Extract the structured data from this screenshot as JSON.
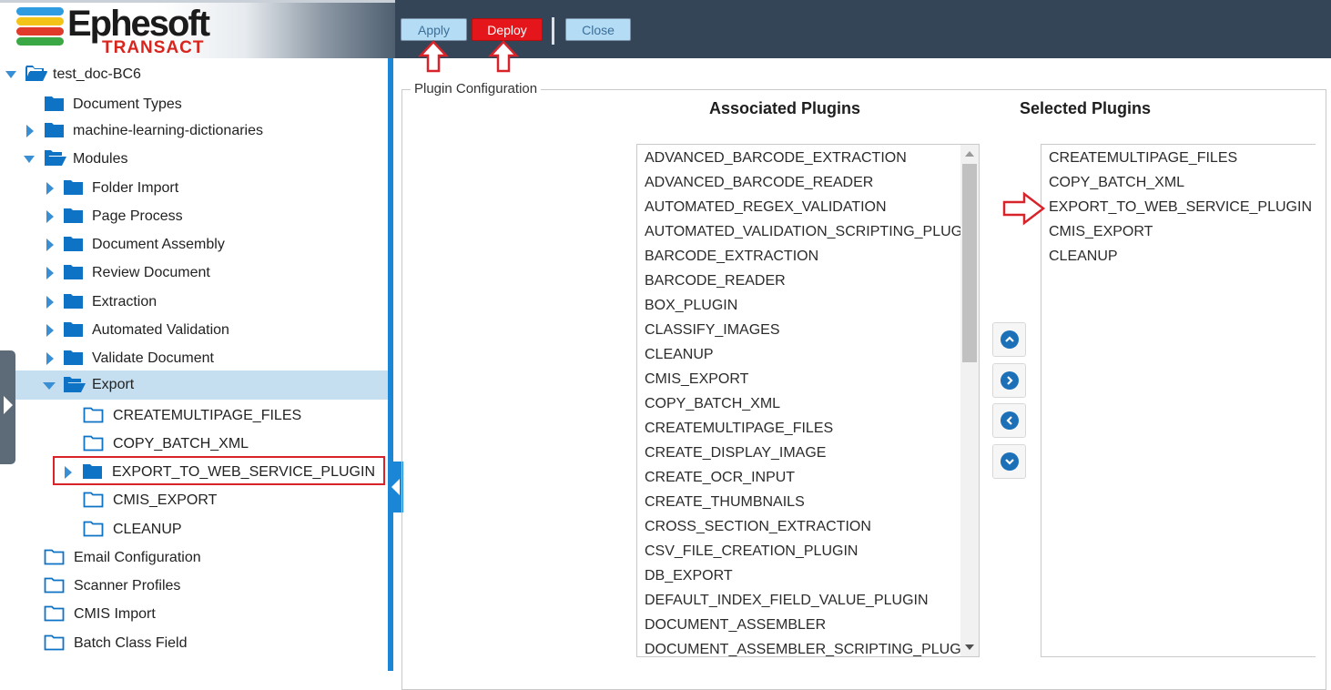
{
  "header": {
    "logo_text": "Ephesoft",
    "logo_subtext": "TRANSACT",
    "apply_label": "Apply",
    "deploy_label": "Deploy",
    "close_label": "Close"
  },
  "colors": {
    "header_bg": "#344558",
    "accent_blue": "#1b85d6",
    "deploy_red": "#e4161b",
    "annotation_red": "#d9232b",
    "selected_row": "#c6dff0"
  },
  "tree": {
    "root": "test_doc-BC6",
    "document_types": "Document Types",
    "ml_dictionaries": "machine-learning-dictionaries",
    "modules": "Modules",
    "module_items": [
      "Folder Import",
      "Page Process",
      "Document Assembly",
      "Review Document",
      "Extraction",
      "Automated Validation",
      "Validate Document"
    ],
    "export": "Export",
    "export_items": [
      "CREATEMULTIPAGE_FILES",
      "COPY_BATCH_XML",
      "EXPORT_TO_WEB_SERVICE_PLUGIN",
      "CMIS_EXPORT",
      "CLEANUP"
    ],
    "bottom_items": [
      "Email Configuration",
      "Scanner Profiles",
      "CMIS Import",
      "Batch Class Field"
    ]
  },
  "plugin_config": {
    "legend": "Plugin Configuration",
    "associated_title": "Associated Plugins",
    "selected_title": "Selected Plugins",
    "associated": [
      "ADVANCED_BARCODE_EXTRACTION",
      "ADVANCED_BARCODE_READER",
      "AUTOMATED_REGEX_VALIDATION",
      "AUTOMATED_VALIDATION_SCRIPTING_PLUGIN",
      "BARCODE_EXTRACTION",
      "BARCODE_READER",
      "BOX_PLUGIN",
      "CLASSIFY_IMAGES",
      "CLEANUP",
      "CMIS_EXPORT",
      "COPY_BATCH_XML",
      "CREATEMULTIPAGE_FILES",
      "CREATE_DISPLAY_IMAGE",
      "CREATE_OCR_INPUT",
      "CREATE_THUMBNAILS",
      "CROSS_SECTION_EXTRACTION",
      "CSV_FILE_CREATION_PLUGIN",
      "DB_EXPORT",
      "DEFAULT_INDEX_FIELD_VALUE_PLUGIN",
      "DOCUMENT_ASSEMBLER",
      "DOCUMENT_ASSEMBLER_SCRIPTING_PLUGIN"
    ],
    "selected": [
      "CREATEMULTIPAGE_FILES",
      "COPY_BATCH_XML",
      "EXPORT_TO_WEB_SERVICE_PLUGIN",
      "CMIS_EXPORT",
      "CLEANUP"
    ],
    "move_buttons": [
      "move-up-icon",
      "move-right-icon",
      "move-left-icon",
      "move-down-icon"
    ]
  }
}
